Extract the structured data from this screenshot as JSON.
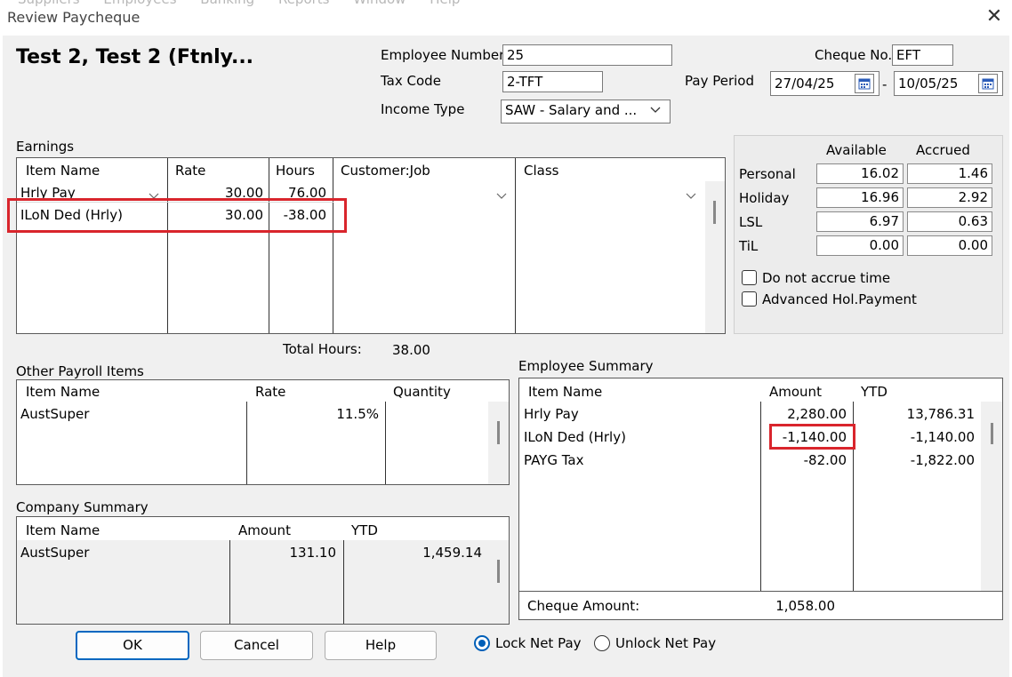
{
  "window": {
    "menu_ghost": [
      "Suppliers",
      "Employees",
      "Banking",
      "Reports",
      "Window",
      "Help"
    ],
    "title": "Review Paycheque",
    "close_glyph": "✕"
  },
  "employee": {
    "name": "Test 2, Test 2 (Ftnly...",
    "number_label": "Employee Number",
    "number": "25",
    "tax_code_label": "Tax Code",
    "tax_code": "2-TFT",
    "income_type_label": "Income Type",
    "income_type": "SAW - Salary and ...",
    "cheque_no_label": "Cheque No.",
    "cheque_no": "EFT",
    "pay_period_label": "Pay Period",
    "pay_period_from": "27/04/25",
    "pay_period_sep": "-",
    "pay_period_to": "10/05/25"
  },
  "earnings": {
    "label": "Earnings",
    "columns": [
      "Item Name",
      "Rate",
      "Hours",
      "Customer:Job",
      "Class"
    ],
    "rows": [
      {
        "item": "Hrly Pay",
        "rate": "30.00",
        "hours": "76.00"
      },
      {
        "item": "ILoN Ded (Hrly)",
        "rate": "30.00",
        "hours": "-38.00"
      }
    ],
    "total_hours_label": "Total Hours:",
    "total_hours": "38.00"
  },
  "accruals": {
    "col_available": "Available",
    "col_accrued": "Accrued",
    "rows": [
      {
        "label": "Personal",
        "available": "16.02",
        "accrued": "1.46"
      },
      {
        "label": "Holiday",
        "available": "16.96",
        "accrued": "2.92"
      },
      {
        "label": "LSL",
        "available": "6.97",
        "accrued": "0.63"
      },
      {
        "label": "TiL",
        "available": "0.00",
        "accrued": "0.00"
      }
    ],
    "do_not_accrue": "Do not accrue time",
    "advanced_hol": "Advanced Hol.Payment"
  },
  "other_payroll": {
    "label": "Other Payroll Items",
    "columns": [
      "Item Name",
      "Rate",
      "Quantity"
    ],
    "rows": [
      {
        "item": "AustSuper",
        "rate": "11.5%",
        "quantity": ""
      }
    ]
  },
  "company_summary": {
    "label": "Company Summary",
    "columns": [
      "Item Name",
      "Amount",
      "YTD"
    ],
    "rows": [
      {
        "item": "AustSuper",
        "amount": "131.10",
        "ytd": "1,459.14"
      }
    ]
  },
  "employee_summary": {
    "label": "Employee Summary",
    "columns": [
      "Item Name",
      "Amount",
      "YTD"
    ],
    "rows": [
      {
        "item": "Hrly Pay",
        "amount": "2,280.00",
        "ytd": "13,786.31"
      },
      {
        "item": "ILoN Ded (Hrly)",
        "amount": "-1,140.00",
        "ytd": "-1,140.00"
      },
      {
        "item": "PAYG Tax",
        "amount": "-82.00",
        "ytd": "-1,822.00"
      }
    ],
    "cheque_amount_label": "Cheque Amount:",
    "cheque_amount": "1,058.00"
  },
  "buttons": {
    "ok": "OK",
    "cancel": "Cancel",
    "help": "Help"
  },
  "net_pay": {
    "lock": "Lock Net Pay",
    "unlock": "Unlock Net Pay",
    "selected": "lock"
  },
  "colors": {
    "highlight": "#d9252c",
    "accent": "#0067c0"
  }
}
